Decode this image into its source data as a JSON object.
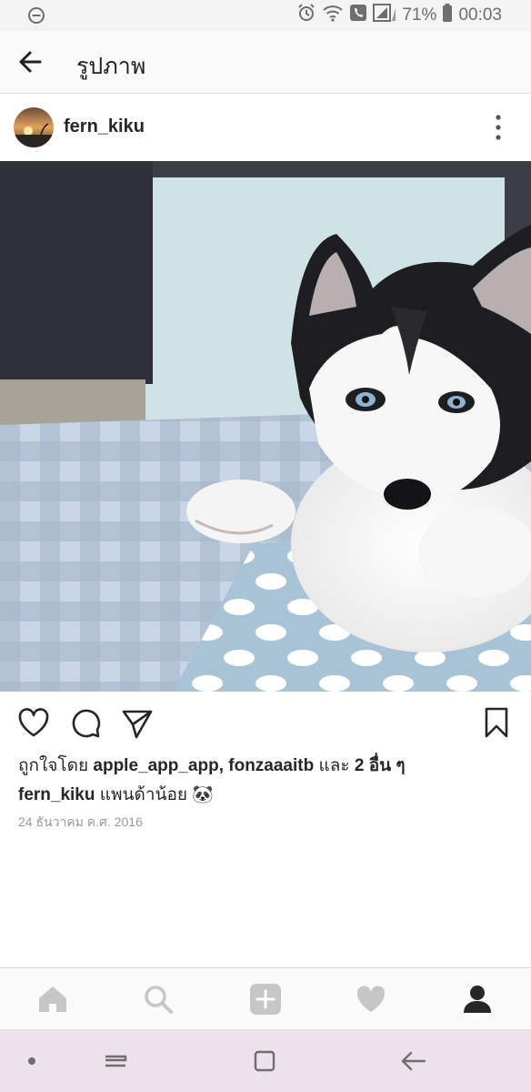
{
  "status_bar": {
    "battery_percent": "71%",
    "time": "00:03"
  },
  "header": {
    "title": "รูปภาพ"
  },
  "post": {
    "username": "fern_kiku",
    "likes": {
      "prefix": "ถูกใจโดย",
      "users": "apple_app_app, fonzaaaitb",
      "conjunction": "และ",
      "others": "2 อื่น ๆ"
    },
    "caption": {
      "username": "fern_kiku",
      "text": "แพนด้าน้อย 🐼"
    },
    "date": "24 ธันวาคม ค.ศ. 2016"
  },
  "icons": {
    "status_left": "dnd-icon",
    "alarm": "alarm-icon",
    "wifi": "wifi-icon",
    "call": "call-icon",
    "signal": "signal-icon",
    "battery": "battery-icon",
    "back": "back-arrow-icon",
    "more": "more-vertical-icon",
    "like": "heart-outline-icon",
    "comment": "comment-icon",
    "share": "send-icon",
    "save": "bookmark-icon",
    "home": "home-icon",
    "search": "search-icon",
    "add": "add-icon",
    "activity": "heart-icon",
    "profile": "profile-icon"
  },
  "colors": {
    "text": "#262626",
    "muted": "#999999",
    "nav_bar": "#fafafa",
    "system_nav": "#ece2ec"
  }
}
